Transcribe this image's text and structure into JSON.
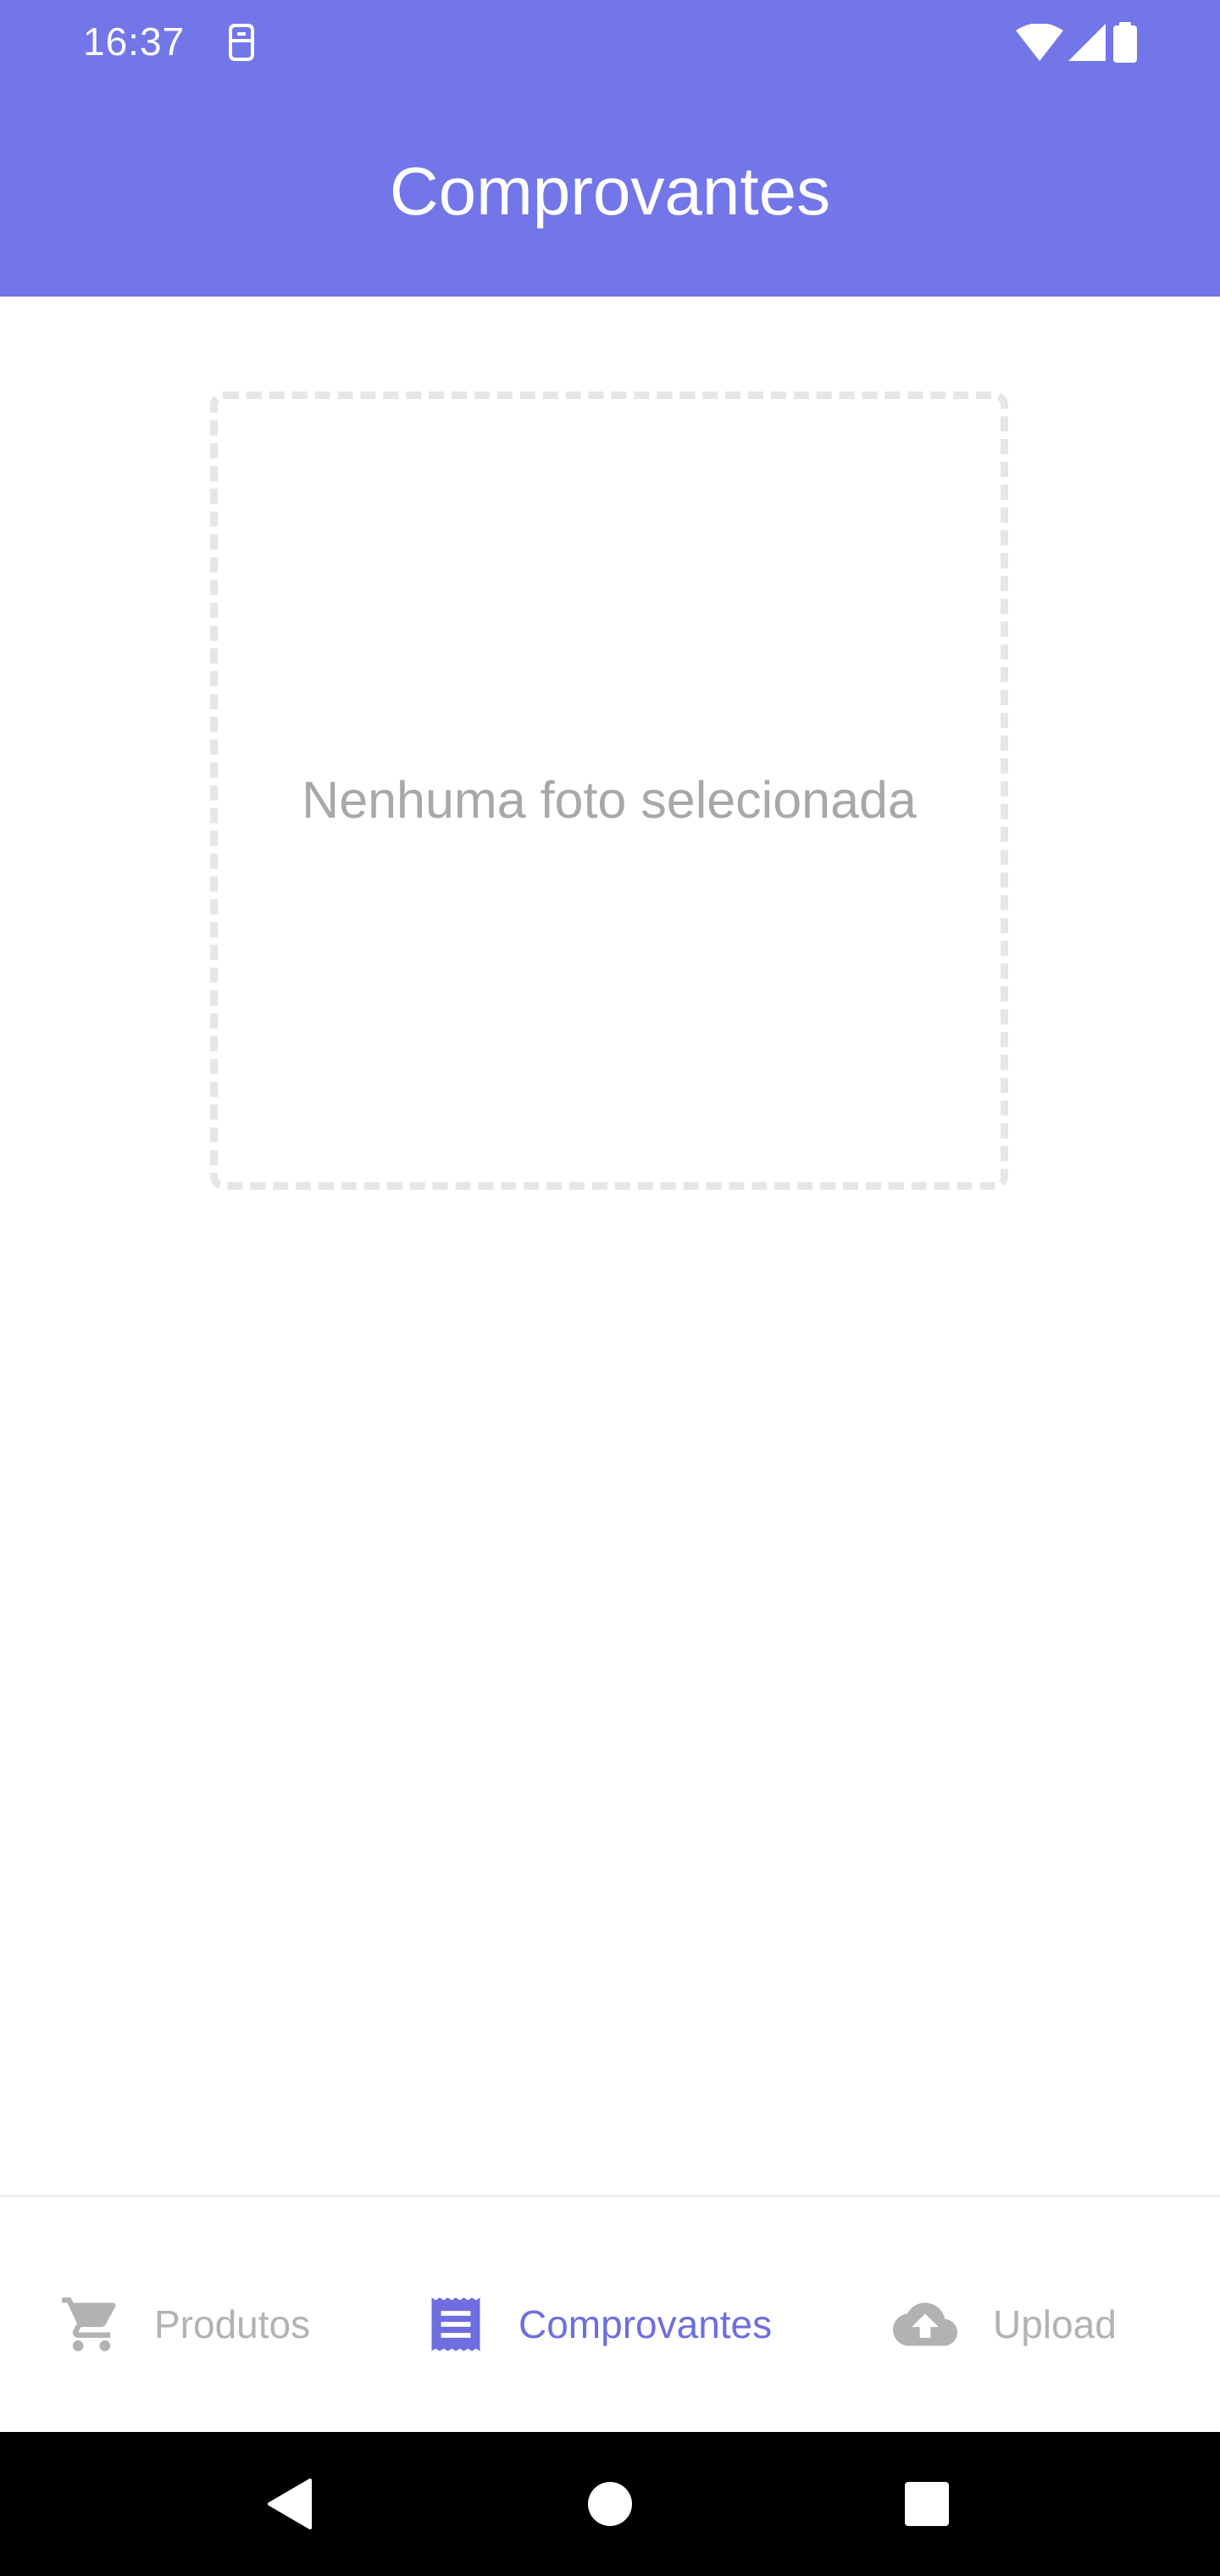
{
  "status_bar": {
    "time": "16:37",
    "left_icon": "sim-card-icon",
    "right_icons": [
      "wifi-icon",
      "cellular-signal-icon",
      "battery-icon"
    ],
    "background_color": "#7276e8"
  },
  "app_bar": {
    "title": "Comprovantes",
    "background_color": "#7276e8"
  },
  "main": {
    "photo_placeholder_text": "Nenhuma foto selecionada"
  },
  "bottom_nav": {
    "active_color": "#6e6ee0",
    "inactive_color": "#b2b2b2",
    "items": [
      {
        "label": "Produtos",
        "icon": "shopping-cart-icon",
        "active": false
      },
      {
        "label": "Comprovantes",
        "icon": "receipt-icon",
        "active": true
      },
      {
        "label": "Upload",
        "icon": "cloud-upload-icon",
        "active": false
      }
    ]
  },
  "system_nav": {
    "buttons": [
      "back-icon",
      "home-icon",
      "recents-icon"
    ]
  }
}
